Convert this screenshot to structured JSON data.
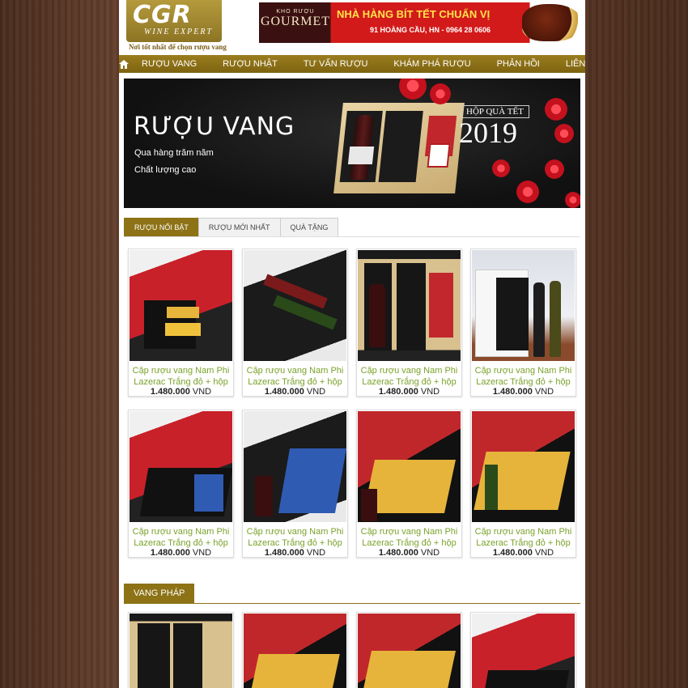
{
  "brand": {
    "logo": "CGR",
    "logo_sub": "WINE EXPERT",
    "tagline": "Nơi tốt nhất để chọn rượu vang"
  },
  "ad": {
    "small": "KHO RƯỢU",
    "brand": "GOURMET",
    "title": "NHÀ HÀNG BÍT TẾT CHUẨN VỊ",
    "address": "91 HOÀNG CẦU, HN - 0964 28 0606"
  },
  "nav": {
    "home_icon": "home-icon",
    "items": [
      "RƯỢU VANG",
      "RƯỢU NHẬT",
      "TƯ VẤN RƯỢU",
      "KHÁM PHÁ RƯỢU",
      "PHẢN HỒI",
      "LIÊN HỆ"
    ]
  },
  "hero": {
    "title": "RƯỢU VANG",
    "line1": "Qua hàng trăm năm",
    "line2": "Chất lượng cao",
    "tag_top": "HỘP QUÀ TẾT",
    "year": "2019"
  },
  "tabs": [
    "RƯỢU NỔI BẬT",
    "RƯỢU MỚI NHẤT",
    "QUÀ TẶNG"
  ],
  "products": [
    {
      "name": "Cặp rượu vang Nam Phi Lazerac Trắng đỏ + hộp",
      "price": "1.480.000",
      "currency": "VND"
    },
    {
      "name": "Cặp rượu vang Nam Phi Lazerac Trắng đỏ + hộp",
      "price": "1.480.000",
      "currency": "VND"
    },
    {
      "name": "Cặp rượu vang Nam Phi Lazerac Trắng đỏ + hộp",
      "price": "1.480.000",
      "currency": "VND"
    },
    {
      "name": "Cặp rượu vang Nam Phi Lazerac Trắng đỏ + hộp",
      "price": "1.480.000",
      "currency": "VND"
    },
    {
      "name": "Cặp rượu vang Nam Phi Lazerac Trắng đỏ + hộp",
      "price": "1.480.000",
      "currency": "VND"
    },
    {
      "name": "Cặp rượu vang Nam Phi Lazerac Trắng đỏ + hộp",
      "price": "1.480.000",
      "currency": "VND"
    },
    {
      "name": "Cặp rượu vang Nam Phi Lazerac Trắng đỏ + hộp",
      "price": "1.480.000",
      "currency": "VND"
    },
    {
      "name": "Cặp rượu vang Nam Phi Lazerac Trắng đỏ + hộp",
      "price": "1.480.000",
      "currency": "VND"
    }
  ],
  "section": {
    "title": "VANG PHÁP"
  }
}
